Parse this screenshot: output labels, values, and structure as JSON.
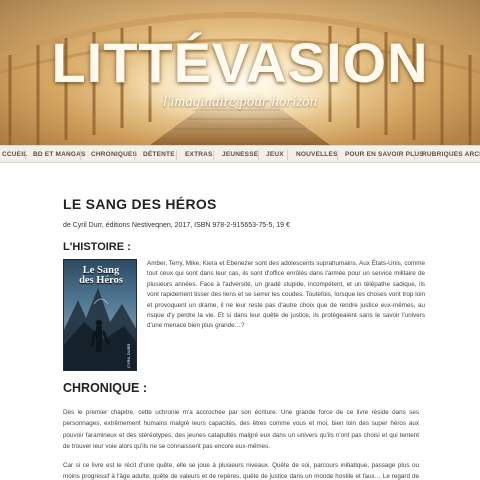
{
  "header": {
    "site_title": "LITTÉVASION",
    "tagline": "l'imaginaire pour horizon"
  },
  "nav": {
    "items": [
      {
        "label": "CCUEIL"
      },
      {
        "label": "BD ET MANGAS"
      },
      {
        "label": "CHRONIQUES"
      },
      {
        "label": "DÉTENTE"
      },
      {
        "label": "EXTRAS"
      },
      {
        "label": "JEUNESSE"
      },
      {
        "label": "JEUX"
      },
      {
        "label": "NOUVELLES"
      },
      {
        "label": "POUR EN SAVOIR PLUS"
      },
      {
        "label": "RUBRIQUES ARCHIVÉE"
      }
    ]
  },
  "post": {
    "title": "LE SANG DES HÉROS",
    "meta": "de Cyril Durr, éditions Nestiveqnen, 2017, ISBN 978-2-915653-75-5, 19 €",
    "histoire_heading": "L'HISTOIRE :",
    "cover": {
      "title_line1": "Le Sang",
      "title_line2": "des Héros",
      "author": "CYRIL DURR"
    },
    "story": "Amber, Terry, Mike, Kiera et Ebenezer sont des adolescents suprahumains. Aux États-Unis, comme tout ceux qui sont dans leur cas, ils sont d'office enrôlés dans l'armée pour un service militaire de plusieurs années. Face à l'adversité, un gradé stupide, incompétent, et un télépathe sadique, ils vont rapidement tisser des liens et se serrer les coudes. Toutefois, lorsque les choses vont trop loin et provoquent un drame, il ne leur reste pas d'autre choix que de rendre justice eux-mêmes, au risque d'y perdre la vie. Et si dans leur quête de justice, ils protégeaient sans le savoir l'univers d'une menace bien plus grande…?",
    "chronique_heading": "CHRONIQUE :",
    "review_p1": "Dès le premier chapitre, cette uchronie m'a accrochée par son écriture. Une grande force de ce livre réside dans ses personnages, extrêmement humains malgré leurs capacités, des êtres comme vous et moi, bien loin des super héros aux pouvoir faramineux et des stéréotypes, des jeunes catapultés malgré eux dans un univers qu'ils n'ont pas choisi et qui tentent de trouver leur voie alors qu'ils ne se connaissent pas encore eux-mêmes.",
    "review_p2": "Car si ce livre est le récit d'une quête, elle se joue à plusieurs niveaux. Quête de soi, parcours initiatique, passage plus ou moins progressif à l'âge adulte, quête de valeurs et de repères, quête de justice dans un monde hostile et faux… Le regard de ces jeunes sur le système est sans illusion, tandis que ceux qui servent le dit système ont perdu leur âme depuis"
  },
  "colors": {
    "banner_gold": "#d7ad6c",
    "nav_bg": "#f3f0ec",
    "title_text": "#222222"
  }
}
